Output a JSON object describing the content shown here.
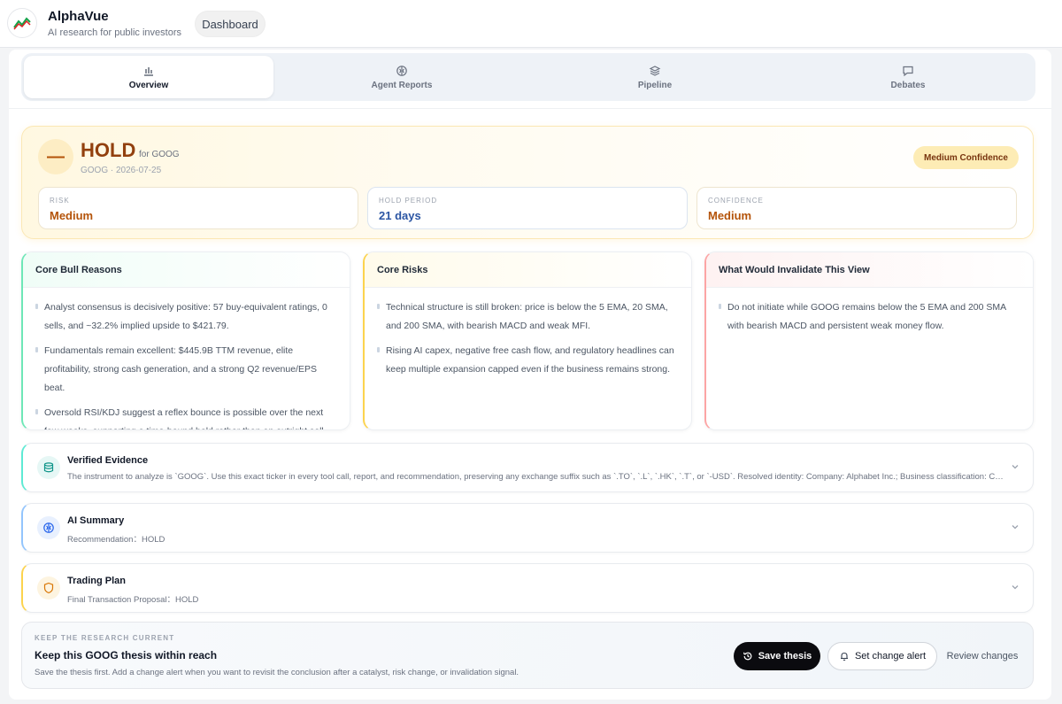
{
  "header": {
    "brand_name": "AlphaVue",
    "brand_tagline": "AI research for public investors",
    "dashboard_label": "Dashboard"
  },
  "tabs": [
    {
      "label": "Overview",
      "icon": "bar-chart-icon",
      "active": true
    },
    {
      "label": "Agent Reports",
      "icon": "brain-icon",
      "active": false
    },
    {
      "label": "Pipeline",
      "icon": "layers-icon",
      "active": false
    },
    {
      "label": "Debates",
      "icon": "chat-icon",
      "active": false
    }
  ],
  "recommendation": {
    "action": "HOLD",
    "for_text": "for GOOG",
    "subtitle": "GOOG · 2026-07-25",
    "confidence_badge": "Medium Confidence",
    "metrics": [
      {
        "label": "RISK",
        "value": "Medium",
        "color": "#b45309"
      },
      {
        "label": "HOLD PERIOD",
        "value": "21 days",
        "color": "#2b55a3"
      },
      {
        "label": "CONFIDENCE",
        "value": "Medium",
        "color": "#b45309"
      }
    ]
  },
  "cards": [
    {
      "title": "Core Bull Reasons",
      "accent": "#34d399",
      "tint": "#ecfdf5",
      "bullets": [
        "Analyst consensus is decisively positive: 57 buy-equivalent ratings, 0 sells, and ~32.2% implied upside to $421.79.",
        "Fundamentals remain excellent: $445.9B TTM revenue, elite profitability, strong cash generation, and a strong Q2 revenue/EPS beat.",
        "Oversold RSI/KDJ suggest a reflex bounce is possible over the next few weeks, supporting a time-bound hold rather than an outright sell."
      ]
    },
    {
      "title": "Core Risks",
      "accent": "#fbbf24",
      "tint": "#fffbeb",
      "bullets": [
        "Technical structure is still broken: price is below the 5 EMA, 20 SMA, and 200 SMA, with bearish MACD and weak MFI.",
        "Rising AI capex, negative free cash flow, and regulatory headlines can keep multiple expansion capped even if the business remains strong."
      ]
    },
    {
      "title": "What Would Invalidate This View",
      "accent": "#f87171",
      "tint": "#fef2f2",
      "bullets": [
        "Do not initiate while GOOG remains below the 5 EMA and 200 SMA with bearish MACD and persistent weak money flow."
      ]
    }
  ],
  "accordions": [
    {
      "title": "Verified Evidence",
      "subtitle": "The instrument to analyze is `GOOG`. Use this exact ticker in every tool call, report, and recommendation, preserving any exchange suffix such as `.TO`, `.L`, `.HK`, `.T`, or `-USD`. Resolved identity: Company: Alphabet Inc.; Business classification: Com...",
      "icon": "database-icon",
      "accent": "#5eead4",
      "icon_color": "#0d9488",
      "icon_bg": "#e6f7f5"
    },
    {
      "title": "AI Summary",
      "subtitle": "Recommendation：HOLD",
      "icon": "brain-icon",
      "accent": "#93c5fd",
      "icon_color": "#2563eb",
      "icon_bg": "#e8f0fe"
    },
    {
      "title": "Trading Plan",
      "subtitle": "Final Transaction Proposal：HOLD",
      "icon": "shield-icon",
      "accent": "#fcd34d",
      "icon_color": "#d97706",
      "icon_bg": "#fdf4e0"
    }
  ],
  "footer": {
    "eyebrow": "KEEP THE RESEARCH CURRENT",
    "title": "Keep this GOOG thesis within reach",
    "description": "Save the thesis first. Add a change alert when you want to revisit the conclusion after a catalyst, risk change, or invalidation signal.",
    "save_label": "Save thesis",
    "alert_label": "Set change alert",
    "review_label": "Review changes"
  }
}
